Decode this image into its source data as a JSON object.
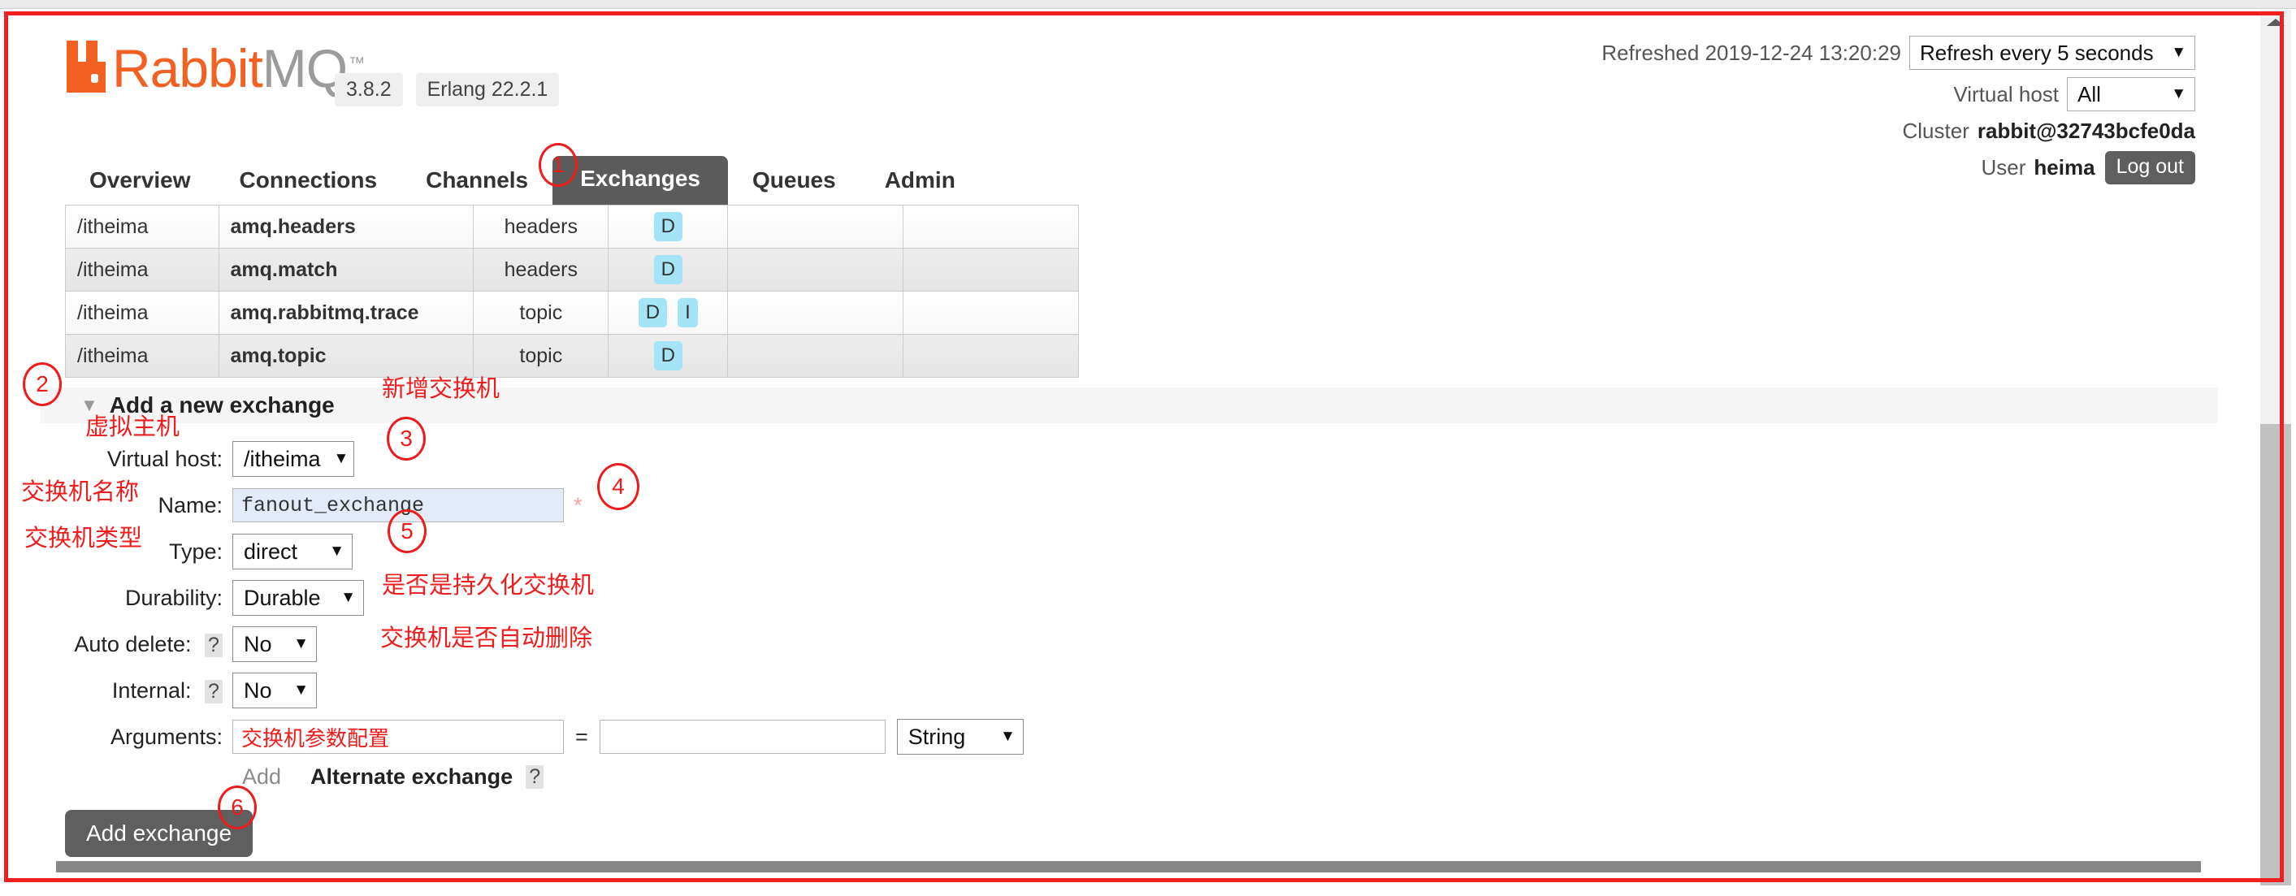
{
  "header": {
    "logo_rabbit": "Rabbit",
    "logo_mq": "MQ",
    "logo_tm": "™",
    "version": "3.8.2",
    "erlang": "Erlang 22.2.1",
    "refreshed_label": "Refreshed 2019-12-24 13:20:29",
    "refresh_select": "Refresh every 5 seconds",
    "vhost_label": "Virtual host",
    "vhost_select": "All",
    "cluster_label": "Cluster",
    "cluster_name": "rabbit@32743bcfe0da",
    "user_label": "User",
    "user_name": "heima",
    "logout_label": "Log out",
    "caret_icon": "▼"
  },
  "nav": {
    "items": [
      {
        "label": "Overview",
        "active": false
      },
      {
        "label": "Connections",
        "active": false
      },
      {
        "label": "Channels",
        "active": false
      },
      {
        "label": "Exchanges",
        "active": true
      },
      {
        "label": "Queues",
        "active": false
      },
      {
        "label": "Admin",
        "active": false
      }
    ]
  },
  "exchanges_table": {
    "rows": [
      {
        "vhost": "/itheima",
        "name": "amq.headers",
        "type": "headers",
        "features": [
          "D"
        ]
      },
      {
        "vhost": "/itheima",
        "name": "amq.match",
        "type": "headers",
        "features": [
          "D"
        ]
      },
      {
        "vhost": "/itheima",
        "name": "amq.rabbitmq.trace",
        "type": "topic",
        "features": [
          "D",
          "I"
        ]
      },
      {
        "vhost": "/itheima",
        "name": "amq.topic",
        "type": "topic",
        "features": [
          "D"
        ]
      }
    ]
  },
  "add_exchange": {
    "section_title": "Add a new exchange",
    "section_caret": "▼",
    "fields": {
      "vhost_label": "Virtual host:",
      "vhost_value": "/itheima",
      "name_label": "Name:",
      "name_value": "fanout_exchange",
      "name_required": "*",
      "type_label": "Type:",
      "type_value": "direct",
      "durability_label": "Durability:",
      "durability_value": "Durable",
      "autodelete_label": "Auto delete:",
      "autodelete_value": "No",
      "internal_label": "Internal:",
      "internal_value": "No",
      "arguments_label": "Arguments:",
      "arguments_key": "交换机参数配置",
      "arguments_value": "",
      "arguments_eq": "=",
      "arguments_type": "String",
      "help_icon": "?",
      "add_link": "Add",
      "alternate_exchange": "Alternate exchange"
    },
    "submit_label": "Add exchange"
  },
  "annotations": {
    "numbers": [
      "1",
      "2",
      "3",
      "4",
      "5",
      "6"
    ],
    "texts": {
      "new_exchange": "新增交换机",
      "virtual_host": "虚拟主机",
      "exchange_name": "交换机名称",
      "exchange_type": "交换机类型",
      "durable_note": "是否是持久化交换机",
      "autodelete_note": "交换机是否自动删除"
    },
    "color": "#ee1c1c"
  }
}
